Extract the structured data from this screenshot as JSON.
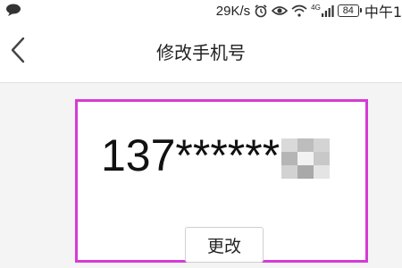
{
  "status_bar": {
    "notification_icon": "chat-bubble-icon",
    "network_speed": "29K/s",
    "icons": [
      "alarm-icon",
      "eye-icon",
      "wifi-icon",
      "signal-icon"
    ],
    "network_type": "4G",
    "battery_level": "84",
    "time": "中午1"
  },
  "nav": {
    "back_icon": "chevron-left-icon",
    "title": "修改手机号"
  },
  "card": {
    "border_color": "#d63ad6",
    "phone_number": "137******",
    "change_label": "更改"
  }
}
